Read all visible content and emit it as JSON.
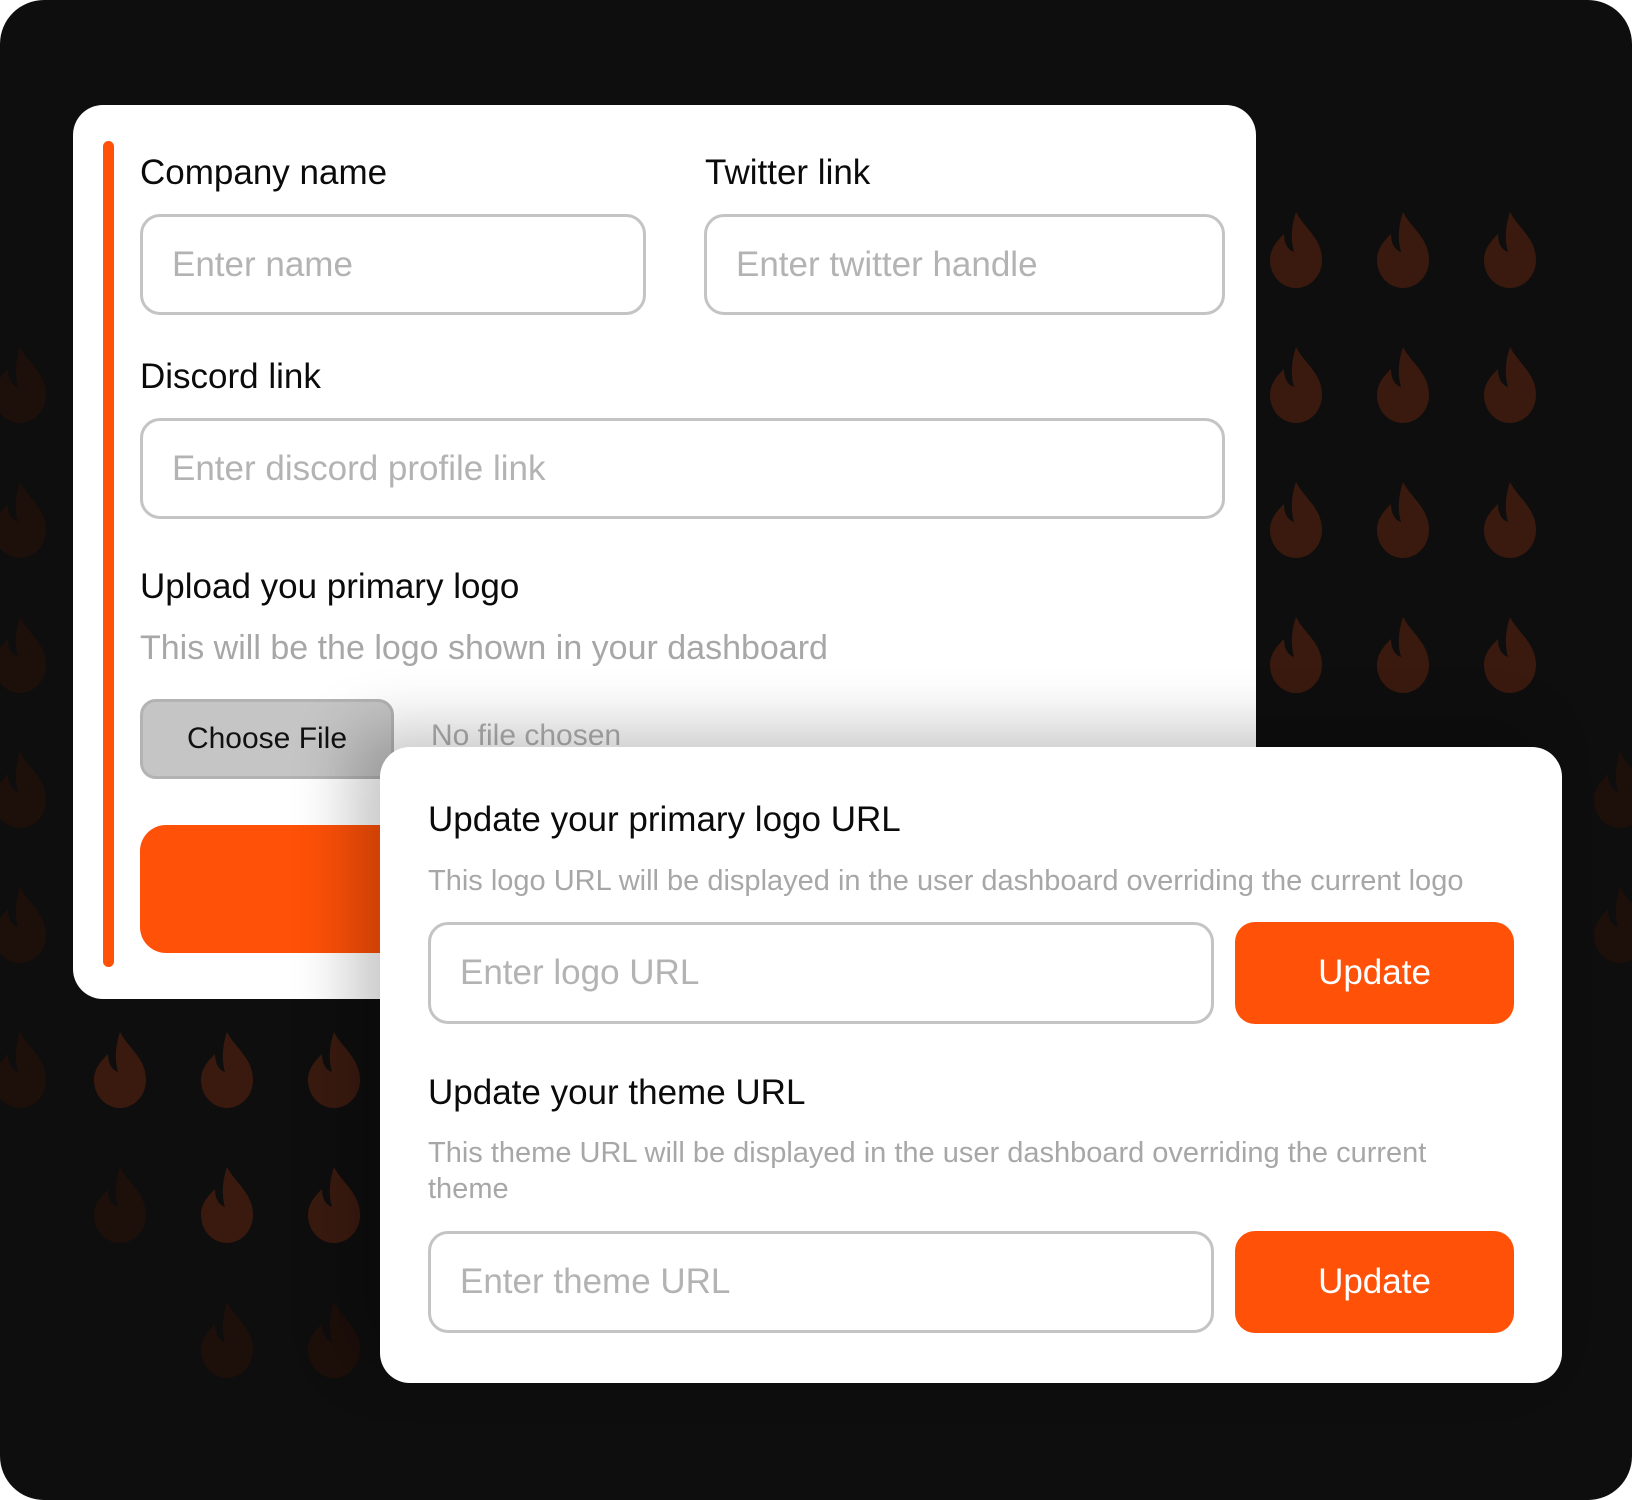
{
  "colors": {
    "accent": "#ff5108",
    "background": "#0e0e0e",
    "pattern": "#3a1a0f"
  },
  "profile_form": {
    "company_name": {
      "label": "Company name",
      "placeholder": "Enter name"
    },
    "twitter": {
      "label": "Twitter link",
      "placeholder": "Enter twitter handle"
    },
    "discord": {
      "label": "Discord link",
      "placeholder": "Enter discord profile link"
    },
    "logo_upload": {
      "title": "Upload you primary logo",
      "description": "This will be the logo shown in your dashboard",
      "button_label": "Choose File",
      "status": "No file chosen"
    }
  },
  "url_settings": {
    "logo": {
      "title": "Update your primary logo URL",
      "description": "This logo URL will be displayed in the user dashboard overriding the current logo",
      "placeholder": "Enter logo URL",
      "button_label": "Update"
    },
    "theme": {
      "title": "Update your theme URL",
      "description": "This theme URL will be displayed in the user dashboard overriding the current theme",
      "placeholder": "Enter theme URL",
      "button_label": "Update"
    }
  }
}
